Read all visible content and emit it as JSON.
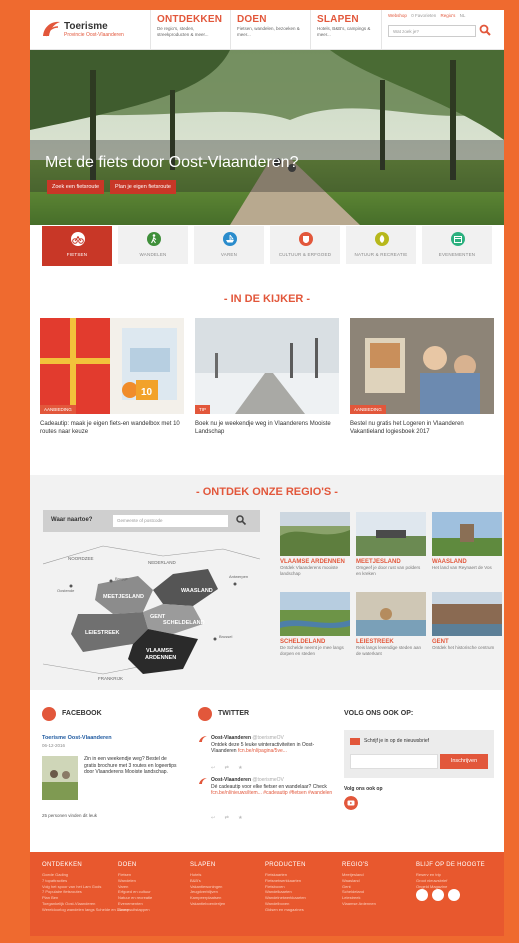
{
  "header": {
    "logo_title": "Toerisme",
    "logo_sub": "Provincie Oost-Vlaanderen",
    "nav": [
      {
        "title": "ONTDEKKEN",
        "sub": "De regio's, steden, streekproducten & meer..."
      },
      {
        "title": "DOEN",
        "sub": "Fietsen, wandelen, bezoeken & meer..."
      },
      {
        "title": "SLAPEN",
        "sub": "Hotels, B&B's, campings & meer..."
      }
    ],
    "util": {
      "webshop": "Webshop",
      "favorites": "0 Favorieten",
      "regios": "Regio's",
      "lang": "NL"
    },
    "search_placeholder": "Wat zoek je?"
  },
  "hero": {
    "title": "Met de fiets door Oost-Vlaanderen?",
    "btn_search": "Zoek een fietsroute",
    "btn_plan": "Plan je eigen fietsroute"
  },
  "themes": [
    {
      "label": "FIETSEN",
      "color": "#c83727"
    },
    {
      "label": "WANDELEN",
      "color": "#3f8f3a"
    },
    {
      "label": "VAREN",
      "color": "#2a8ccc"
    },
    {
      "label": "CULTUUR & ERFGOED",
      "color": "#e2573b"
    },
    {
      "label": "NATUUR & RECREATIE",
      "color": "#b7b81c"
    },
    {
      "label": "EVENEMENTEN",
      "color": "#2bb07e"
    }
  ],
  "kijker": {
    "title": "- IN DE KIJKER -",
    "cards": [
      {
        "tag": "AANBIEDING",
        "text": "Cadeautip: maak je eigen fiets-en wandelbox met 10 routes naar keuze"
      },
      {
        "tag": "TIP",
        "text": "Boek nu je weekendje weg in Vlaanderens Mooiste Landschap"
      },
      {
        "tag": "AANBIEDING",
        "text": "Bestel nu gratis het Logeren in Vlaanderen Vakantieland logiesboek 2017"
      }
    ],
    "badge": "10"
  },
  "regio": {
    "title": "- ONTDEK ONZE REGIO'S -",
    "search_label": "Waar naartoe?",
    "search_placeholder": "Gemeente of postcode",
    "map_labels": {
      "noordzee": "NOORDZEE",
      "nederland": "NEDERLAND",
      "frankrijk": "FRANKRIJK",
      "brugge": "Brugge",
      "oostende": "Oostende",
      "antwerpen": "Antwerpen",
      "brussel": "Brussel",
      "meetjesland": "MEETJESLAND",
      "waasland": "WAASLAND",
      "gent": "GENT",
      "scheldeland": "SCHELDELAND",
      "leiestreek": "LEIESTREEK",
      "vlaamse_ardennen_1": "VLAAMSE",
      "vlaamse_ardennen_2": "ARDENNEN"
    },
    "regions": [
      {
        "name": "VLAAMSE ARDENNEN",
        "desc": "Ontdek Vlaanderens mooiste landschap"
      },
      {
        "name": "MEETJESLAND",
        "desc": "Omgeef je door rust van polders en kreken"
      },
      {
        "name": "WAASLAND",
        "desc": "Het land van Reynaert de Vos"
      },
      {
        "name": "SCHELDELAND",
        "desc": "De Schelde neemt je mee langs dorpen en steden"
      },
      {
        "name": "LEIESTREEK",
        "desc": "Reis langs levendige steden aan de waterkant"
      },
      {
        "name": "GENT",
        "desc": "Ontdek het historische centrum"
      }
    ]
  },
  "facebook": {
    "title": "FACEBOOK",
    "name": "Toerisme Oost-Vlaanderen",
    "date": "06-12-2016",
    "text": "Zin in een weekendje weg? Bestel de gratis brochure met 3 routes en logeertips door Vlaanderens Mooiste landschap.",
    "likes": "25 personen vinden dit leuk"
  },
  "twitter": {
    "title": "TWITTER",
    "tweets": [
      {
        "name": "Oost-Vlaanderen",
        "handle": "@toerismeOV",
        "text": "Ontdek deze 5 leuke winteractiviteiten in Oost-Vlaanderen",
        "link": "fcn.be/nl/pagina/5ve..."
      },
      {
        "name": "Oost-Vlaanderen",
        "handle": "@toerismeOV",
        "text": "Dé cadeautip voor elke fietser en wandelaar? Check",
        "link": "fcn.be/nl/nieuws/item... #cadeautip #fietsen #wandelen"
      }
    ]
  },
  "follow": {
    "title": "VOLG ONS OOK OP:",
    "newsletter": "Schrijf je in op de nieuwsbrief",
    "subscribe": "Inschrijven",
    "sub": "Volg ons ook op"
  },
  "footer": {
    "columns": [
      {
        "title": "ONTDEKKEN",
        "items": [
          "Goede Gading",
          "7 topattracties",
          "Volg het spoor van het Lam Gods",
          "7 Populaire fietsroutes",
          "Plan Ben",
          "Toegankelijk Oost-Vlaanderen",
          "Wereldoorlog wandelen langs Schelde en Durme"
        ]
      },
      {
        "title": "DOEN",
        "items": [
          "Fietsen",
          "Wandelen",
          "Varen",
          "Erfgoed en cultuur",
          "Natuur en recreatie",
          "Evenementen",
          "Groepsuitstappen"
        ]
      },
      {
        "title": "SLAPEN",
        "items": [
          "Hotels",
          "B&B's",
          "Vakantiewoningen",
          "Jeugdverblijven",
          "Kampeerplaatsen",
          "Vakantieboerderijen"
        ]
      },
      {
        "title": "PRODUCTEN",
        "items": [
          "Fietskaarten",
          "Fietsnetwerkkaarten",
          "Fietsboxen",
          "Wandelkaarten",
          "Wandelnetwerkkaarten",
          "Wandelboxen",
          "Gidsen en magazines"
        ]
      },
      {
        "title": "REGIO'S",
        "items": [
          "Meetjesland",
          "Waasland",
          "Gent",
          "Scheldeland",
          "Leiestreek",
          "Vlaamse Ardennen"
        ]
      },
      {
        "title": "BLIJF OP DE HOOGTE",
        "items": [
          "Reserv en trip",
          "Groot nieuwsbrief",
          "Ongeld Magazine"
        ]
      }
    ]
  }
}
